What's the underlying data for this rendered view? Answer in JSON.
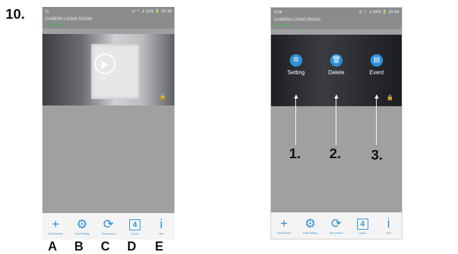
{
  "step_number": "10.",
  "phone_a": {
    "status_left": "⊟",
    "status_right": "⊙ ⇡ .ıl 32% 🔋 20:38",
    "camera_name": "CAMERA LIVING ROOM",
    "connection": "Connected",
    "play_label": "Play",
    "bottom_bar": [
      {
        "icon": "plus-icon",
        "glyph": "+",
        "label": "Add Device"
      },
      {
        "icon": "gear-icon",
        "glyph": "⚙",
        "label": "Edit Setting"
      },
      {
        "icon": "refresh-icon",
        "glyph": "⟳",
        "label": "Reconnect"
      },
      {
        "icon": "quad-icon",
        "glyph": "4",
        "label": "Quad"
      },
      {
        "icon": "info-icon",
        "glyph": "i",
        "label": "Info"
      }
    ]
  },
  "phone_b": {
    "status_left": "⊟ ⊞",
    "status_right": "⊙ ⇡ .ıl 34% 🔋 20:49",
    "camera_name": "CAMERA LIVING ROOM",
    "connection": "Connected",
    "actions": [
      {
        "icon": "settings-icon",
        "glyph": "⚙",
        "label": "Setting"
      },
      {
        "icon": "trash-icon",
        "glyph": "🗑",
        "label": "Delete"
      },
      {
        "icon": "event-icon",
        "glyph": "▤",
        "label": "Event"
      }
    ],
    "numbers": [
      "1.",
      "2.",
      "3."
    ]
  },
  "letters": [
    "A",
    "B",
    "C",
    "D",
    "E"
  ]
}
